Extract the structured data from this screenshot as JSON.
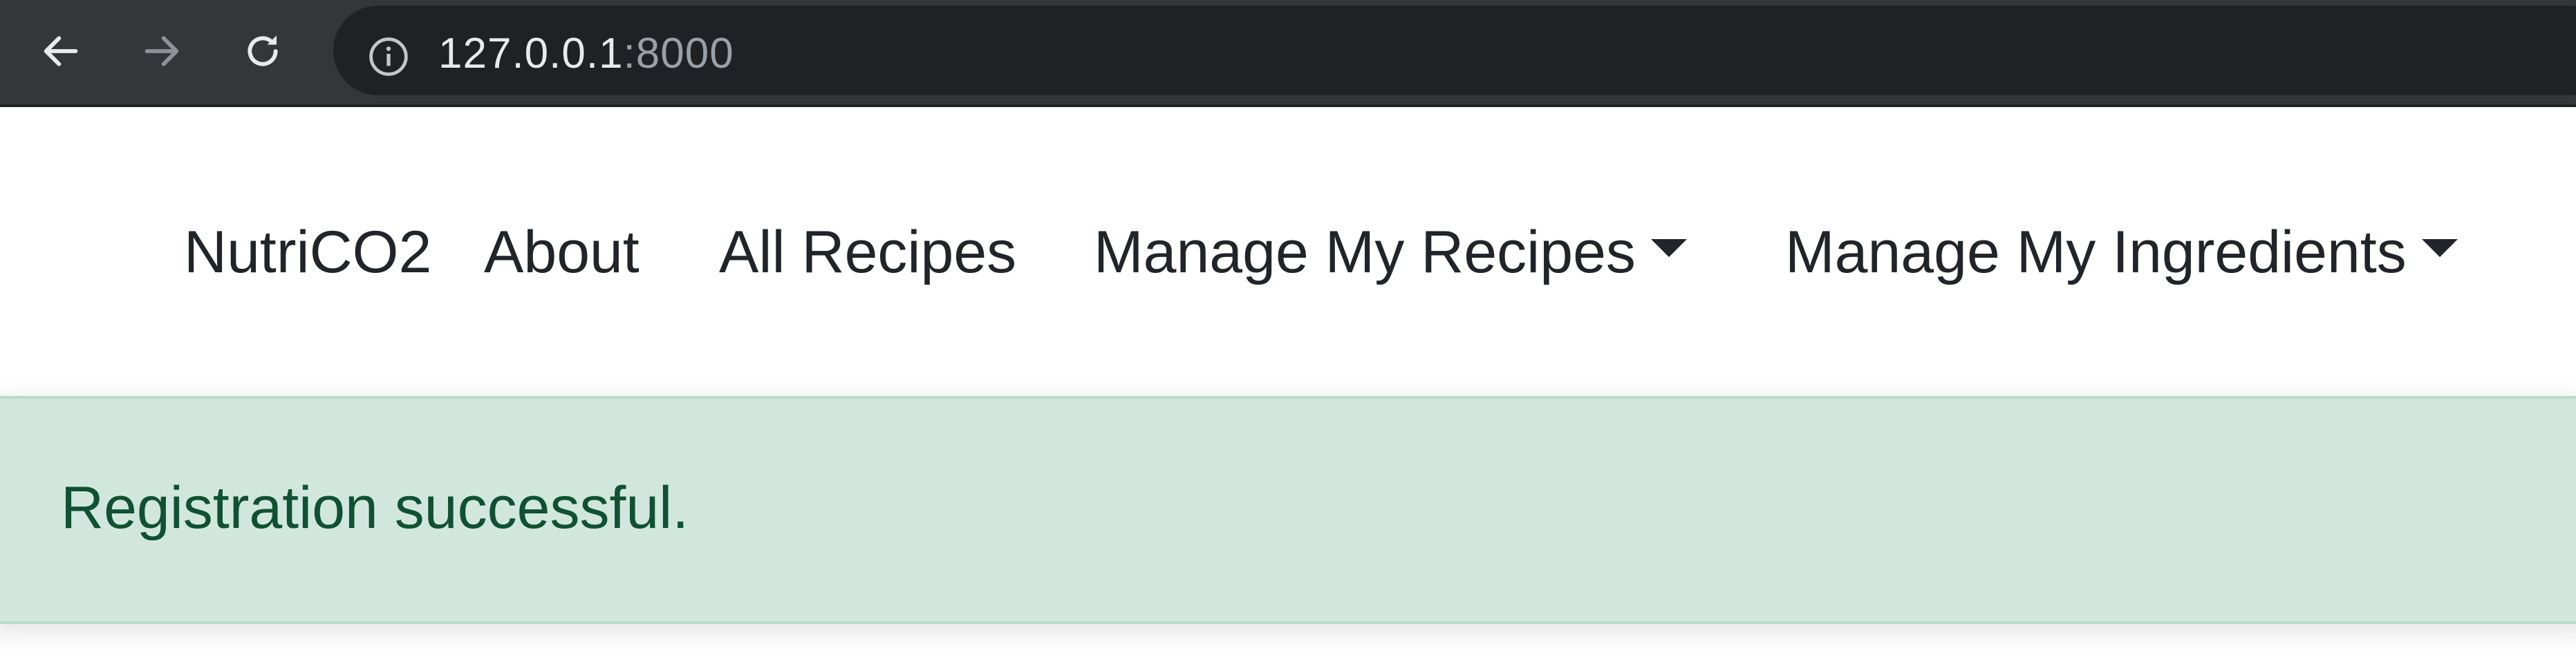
{
  "browser": {
    "url_host": "127.0.0.1",
    "url_port": ":8000",
    "back_icon": "arrow-left-icon",
    "forward_icon": "arrow-right-icon",
    "reload_icon": "reload-icon",
    "site_info_icon": "info-circle-icon"
  },
  "navbar": {
    "brand": "NutriCO2",
    "links": {
      "about": "About",
      "all_recipes": "All Recipes",
      "manage_recipes": "Manage My Recipes",
      "manage_ingredients": "Manage My Ingredients"
    },
    "dropdown_icon": "caret-down-icon"
  },
  "alert": {
    "message": "Registration successful.",
    "colors": {
      "background": "#d1e7dd",
      "border": "#badbcc",
      "text": "#0f5132"
    }
  },
  "colors": {
    "browser_bar": "#35363a",
    "omnibox": "#202124",
    "nav_text": "#212529"
  }
}
